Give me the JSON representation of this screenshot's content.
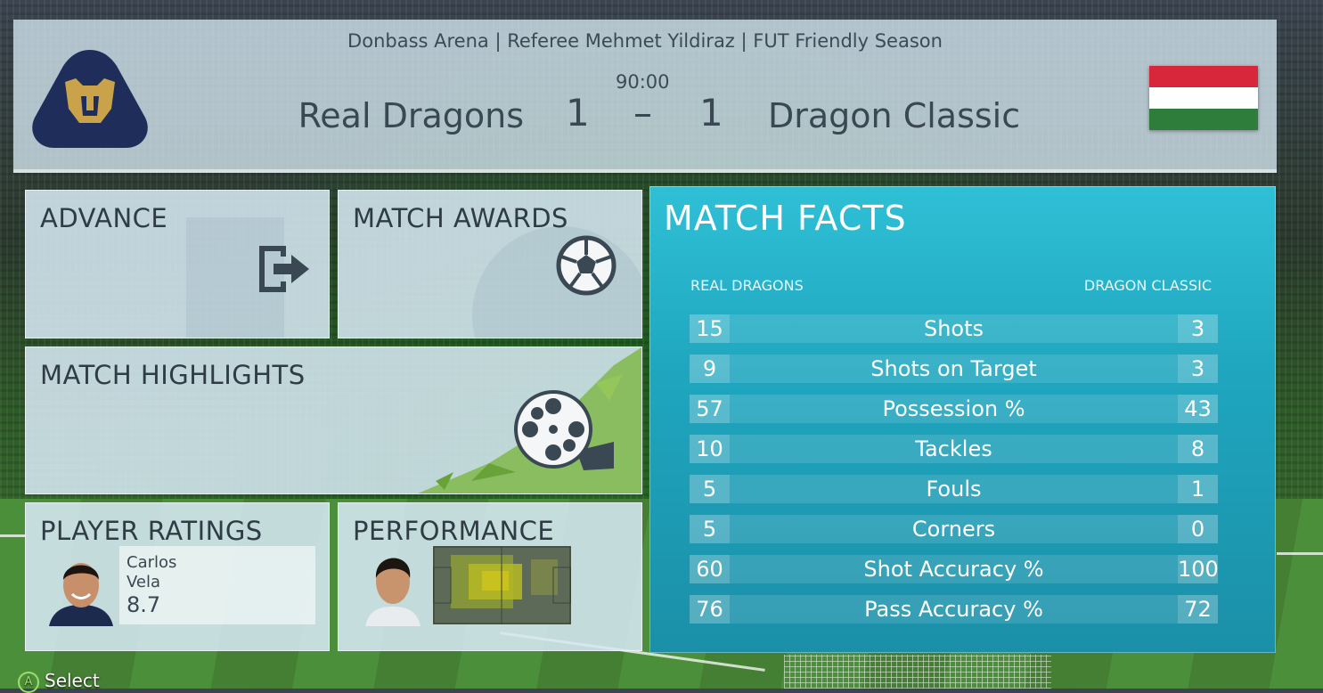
{
  "header": {
    "subtitle": "Donbass Arena | Referee Mehmet Yildiraz | FUT Friendly Season",
    "clock": "90:00",
    "home_team": "Real Dragons",
    "away_team": "Dragon Classic",
    "home_score": "1",
    "separator": "–",
    "away_score": "1",
    "home_crest_icon": "puma-crest-icon",
    "away_flag_icon": "hungary-flag-icon",
    "flag_colors": [
      "#d8263a",
      "#ffffff",
      "#2f7d3b"
    ]
  },
  "tiles": {
    "advance": {
      "label": "ADVANCE",
      "icon": "exit-arrow-icon"
    },
    "match_awards": {
      "label": "MATCH AWARDS",
      "icon": "soccer-ball-icon"
    },
    "match_highlights": {
      "label": "MATCH HIGHLIGHTS",
      "icon": "film-reel-icon"
    },
    "player_ratings": {
      "label": "PLAYER RATINGS",
      "player_first": "Carlos",
      "player_last": "Vela",
      "rating": "8.7"
    },
    "performance": {
      "label": "PERFORMANCE",
      "icon": "heatmap-icon"
    }
  },
  "match_facts": {
    "title": "MATCH FACTS",
    "home_header": "REAL DRAGONS",
    "away_header": "DRAGON CLASSIC",
    "rows": [
      {
        "home": "15",
        "label": "Shots",
        "away": "3"
      },
      {
        "home": "9",
        "label": "Shots on Target",
        "away": "3"
      },
      {
        "home": "57",
        "label": "Possession %",
        "away": "43"
      },
      {
        "home": "10",
        "label": "Tackles",
        "away": "8"
      },
      {
        "home": "5",
        "label": "Fouls",
        "away": "1"
      },
      {
        "home": "5",
        "label": "Corners",
        "away": "0"
      },
      {
        "home": "60",
        "label": "Shot Accuracy %",
        "away": "100"
      },
      {
        "home": "76",
        "label": "Pass Accuracy %",
        "away": "72"
      }
    ]
  },
  "footer": {
    "button": "A",
    "action": "Select"
  },
  "colors": {
    "facts_accent": "#22b0c8",
    "tile_bg": "#d6e8f2",
    "text_dark": "#2f3c46"
  }
}
